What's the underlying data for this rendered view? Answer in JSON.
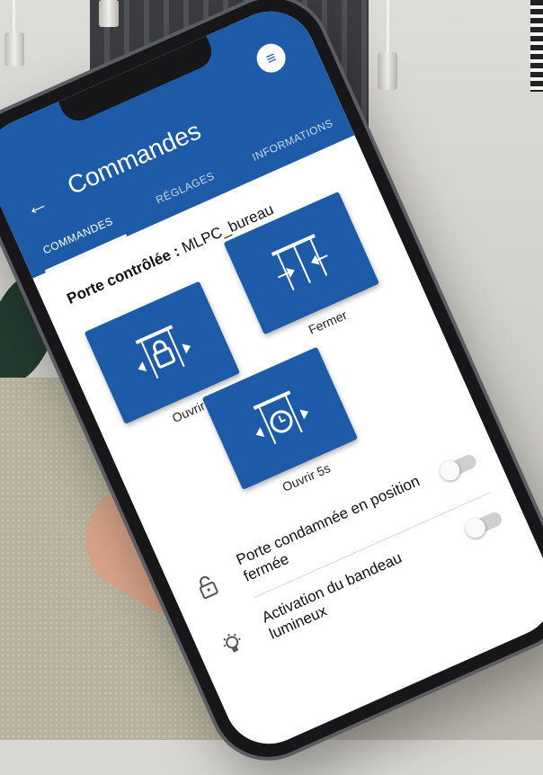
{
  "app": {
    "title": "Commandes",
    "tabs": [
      {
        "label": "COMMANDES",
        "active": true
      },
      {
        "label": "RÉGLAGES",
        "active": false
      },
      {
        "label": "INFORMATIONS",
        "active": false
      }
    ]
  },
  "door": {
    "label": "Porte contrôlée :",
    "value": "MLPC_bureau"
  },
  "commands": [
    {
      "label": "Ouvrir",
      "icon": "door-open-lock-icon"
    },
    {
      "label": "Fermer",
      "icon": "door-close-icon"
    },
    {
      "label": "Ouvrir 5s",
      "icon": "door-open-timer-icon"
    }
  ],
  "settings": [
    {
      "label": "Porte condamnée en position fermée",
      "icon": "padlock-icon",
      "enabled": false
    },
    {
      "label": "Activation du bandeau lumineux",
      "icon": "light-bulb-icon",
      "enabled": false
    }
  ],
  "colors": {
    "primary": "#1d5aa7",
    "background": "#ffffff"
  }
}
